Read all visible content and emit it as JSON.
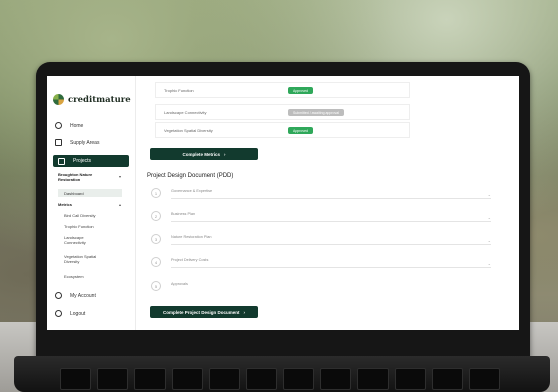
{
  "app": {
    "name": "creditmature"
  },
  "sidebar": {
    "items": [
      {
        "label": "Home"
      },
      {
        "label": "Supply Areas"
      },
      {
        "label": "Projects"
      }
    ],
    "project": {
      "name": "Broughton Nature Restoration"
    },
    "sub_items": [
      {
        "label": "Dashboard"
      },
      {
        "label": "Metrics"
      }
    ],
    "metrics": [
      {
        "label": "Bird Call Diversity"
      },
      {
        "label": "Trophic Function"
      },
      {
        "label": "Landscape Connectivity"
      },
      {
        "label": "Vegetation Spatial Diversity"
      },
      {
        "label": "Ecosystem"
      }
    ],
    "footer": [
      {
        "label": "My Account"
      },
      {
        "label": "Logout"
      }
    ]
  },
  "metrics_table": {
    "rows": [
      {
        "label": "Trophic Function",
        "status": "Approved",
        "status_color": "#2fa85a"
      },
      {
        "label": "Landscape Connectivity",
        "status": "Submitted / awaiting approval",
        "status_color": "#bdbdbd"
      },
      {
        "label": "Vegetation Spatial Diversity",
        "status": "Approved",
        "status_color": "#2fa85a"
      }
    ],
    "complete_button": "Complete Metrics",
    "arrow": "›"
  },
  "pdd": {
    "title": "Project Design Document (PDD)",
    "steps": [
      {
        "num": "1",
        "label": "Governance & Expertise"
      },
      {
        "num": "2",
        "label": "Business Plan"
      },
      {
        "num": "3",
        "label": "Nature Restoration Plan"
      },
      {
        "num": "4",
        "label": "Project Delivery Costs"
      },
      {
        "num": "5",
        "label": "Approvals"
      }
    ],
    "complete_button": "Complete Project Design Document",
    "arrow": "›"
  },
  "colors": {
    "primary": "#123a2e",
    "success": "#2fa85a"
  }
}
